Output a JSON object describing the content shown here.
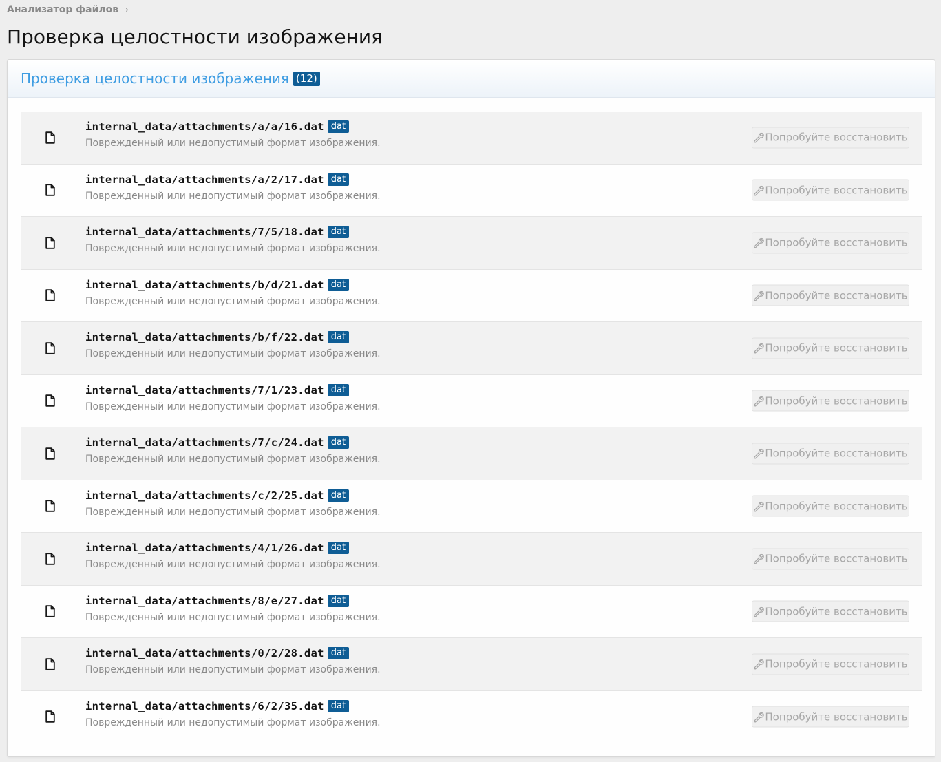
{
  "breadcrumb": {
    "label": "Анализатор файлов",
    "separator": "›"
  },
  "page_title": "Проверка целостности изображения",
  "block": {
    "title": "Проверка целостности изображения",
    "count": "(12)"
  },
  "colors": {
    "accent": "#3f9de2",
    "badge": "#0f5d95",
    "muted": "#8a8a8a"
  },
  "row_icon": "file-icon",
  "button_icon": "wrench-icon",
  "rows": [
    {
      "path": "internal_data/attachments/a/a/16.dat",
      "ext": "dat",
      "desc": "Поврежденный или недопустимый формат изображения.",
      "button": "Попробуйте восстановить"
    },
    {
      "path": "internal_data/attachments/a/2/17.dat",
      "ext": "dat",
      "desc": "Поврежденный или недопустимый формат изображения.",
      "button": "Попробуйте восстановить"
    },
    {
      "path": "internal_data/attachments/7/5/18.dat",
      "ext": "dat",
      "desc": "Поврежденный или недопустимый формат изображения.",
      "button": "Попробуйте восстановить"
    },
    {
      "path": "internal_data/attachments/b/d/21.dat",
      "ext": "dat",
      "desc": "Поврежденный или недопустимый формат изображения.",
      "button": "Попробуйте восстановить"
    },
    {
      "path": "internal_data/attachments/b/f/22.dat",
      "ext": "dat",
      "desc": "Поврежденный или недопустимый формат изображения.",
      "button": "Попробуйте восстановить"
    },
    {
      "path": "internal_data/attachments/7/1/23.dat",
      "ext": "dat",
      "desc": "Поврежденный или недопустимый формат изображения.",
      "button": "Попробуйте восстановить"
    },
    {
      "path": "internal_data/attachments/7/c/24.dat",
      "ext": "dat",
      "desc": "Поврежденный или недопустимый формат изображения.",
      "button": "Попробуйте восстановить"
    },
    {
      "path": "internal_data/attachments/c/2/25.dat",
      "ext": "dat",
      "desc": "Поврежденный или недопустимый формат изображения.",
      "button": "Попробуйте восстановить"
    },
    {
      "path": "internal_data/attachments/4/1/26.dat",
      "ext": "dat",
      "desc": "Поврежденный или недопустимый формат изображения.",
      "button": "Попробуйте восстановить"
    },
    {
      "path": "internal_data/attachments/8/e/27.dat",
      "ext": "dat",
      "desc": "Поврежденный или недопустимый формат изображения.",
      "button": "Попробуйте восстановить"
    },
    {
      "path": "internal_data/attachments/0/2/28.dat",
      "ext": "dat",
      "desc": "Поврежденный или недопустимый формат изображения.",
      "button": "Попробуйте восстановить"
    },
    {
      "path": "internal_data/attachments/6/2/35.dat",
      "ext": "dat",
      "desc": "Поврежденный или недопустимый формат изображения.",
      "button": "Попробуйте восстановить"
    }
  ]
}
